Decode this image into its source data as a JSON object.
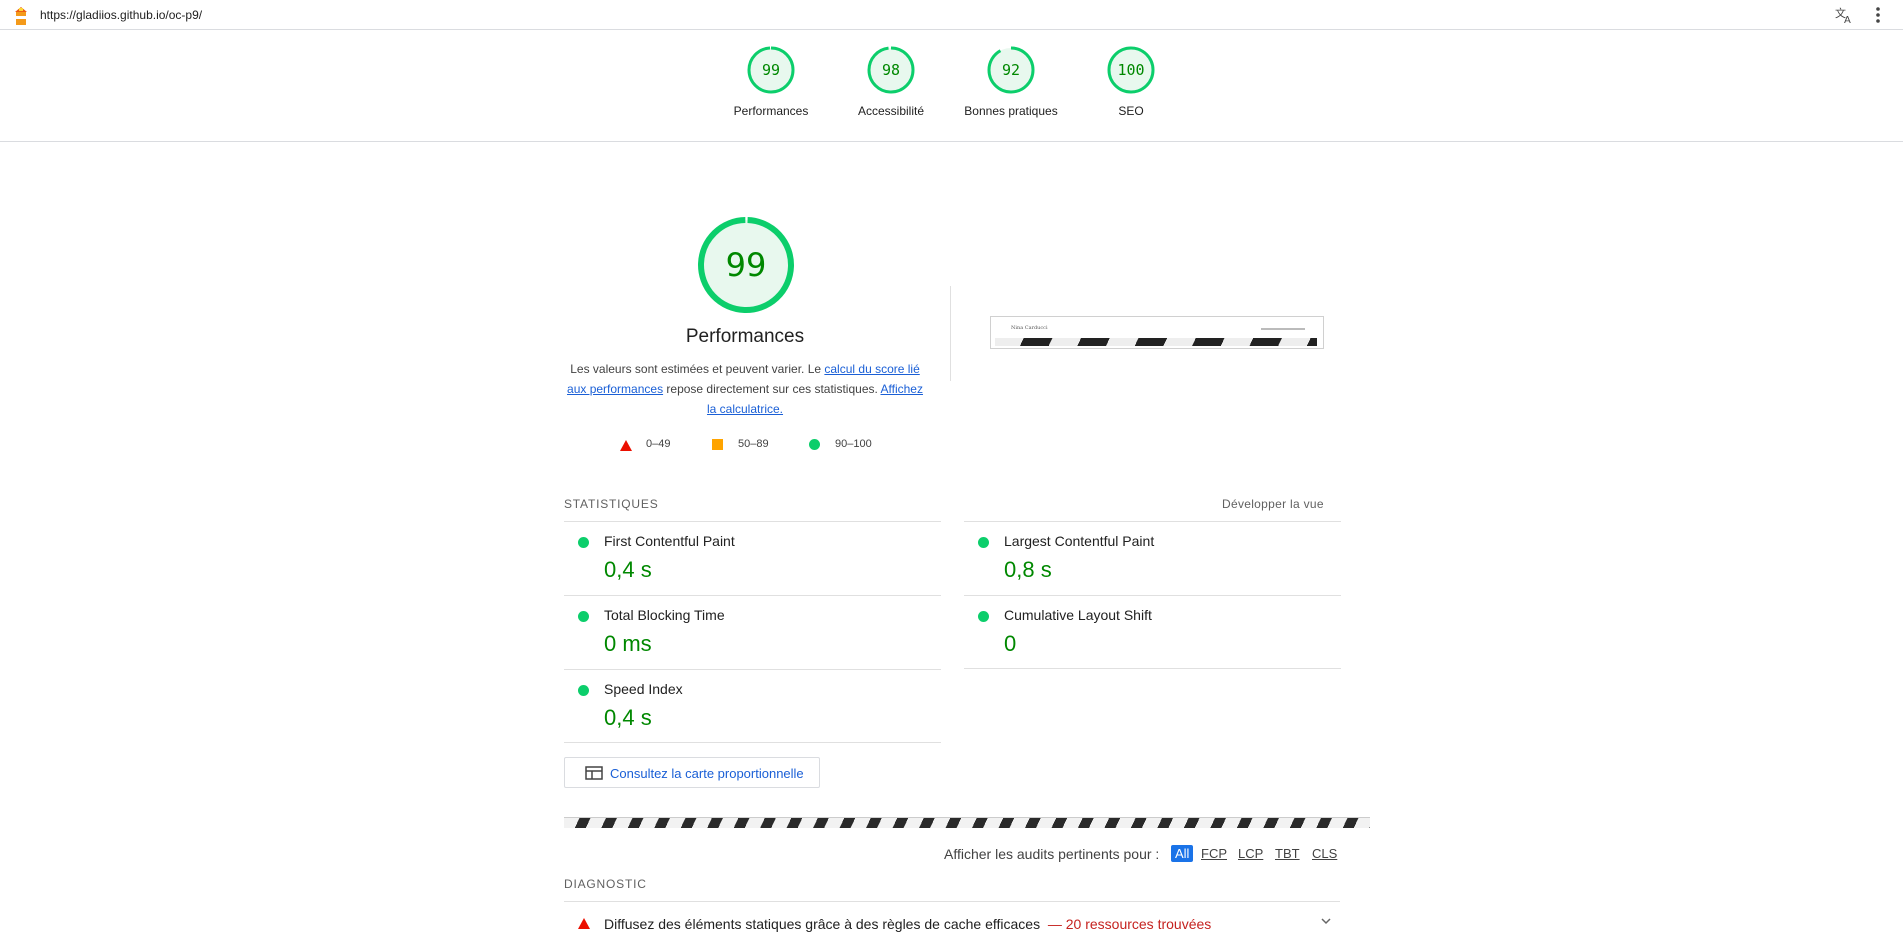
{
  "browser": {
    "url": "https://gladiios.github.io/oc-p9/"
  },
  "categories": [
    {
      "score": "99",
      "label": "Performances"
    },
    {
      "score": "98",
      "label": "Accessibilité"
    },
    {
      "score": "92",
      "label": "Bonnes pratiques"
    },
    {
      "score": "100",
      "label": "SEO"
    }
  ],
  "performance": {
    "score": "99",
    "title": "Performances",
    "desc_1": "Les valeurs sont estimées et peuvent varier. Le ",
    "link_1": "calcul du score lié aux performances",
    "desc_2": " repose directement sur ces statistiques. ",
    "link_2": "Affichez la calculatrice.",
    "scale": [
      {
        "shape": "triangle",
        "range": "0–49"
      },
      {
        "shape": "square",
        "range": "50–89"
      },
      {
        "shape": "circle",
        "range": "90–100"
      }
    ]
  },
  "screenshot": {
    "site_title": "Nina Carducci"
  },
  "metrics_section": {
    "label": "STATISTIQUES",
    "toggle": "Développer la vue",
    "metrics": [
      {
        "title": "First Contentful Paint",
        "value": "0,4 s"
      },
      {
        "title": "Largest Contentful Paint",
        "value": "0,8 s"
      },
      {
        "title": "Total Blocking Time",
        "value": "0 ms"
      },
      {
        "title": "Cumulative Layout Shift",
        "value": "0"
      },
      {
        "title": "Speed Index",
        "value": "0,4 s"
      }
    ],
    "treemap_button": "Consultez la carte proportionnelle"
  },
  "filter": {
    "label": "Afficher les audits pertinents pour :",
    "chips": [
      "All",
      "FCP",
      "LCP",
      "TBT",
      "CLS"
    ]
  },
  "diagnostic": {
    "label": "DIAGNOSTIC",
    "audits": [
      {
        "title": "Diffusez des éléments statiques grâce à des règles de cache efficaces",
        "display": "— 20 ressources trouvées"
      }
    ]
  },
  "colors": {
    "pass": "#0cce6b",
    "pass_text": "#008800",
    "fail": "#eb0f00",
    "average": "#ffa400",
    "link": "#1a5fd6"
  }
}
